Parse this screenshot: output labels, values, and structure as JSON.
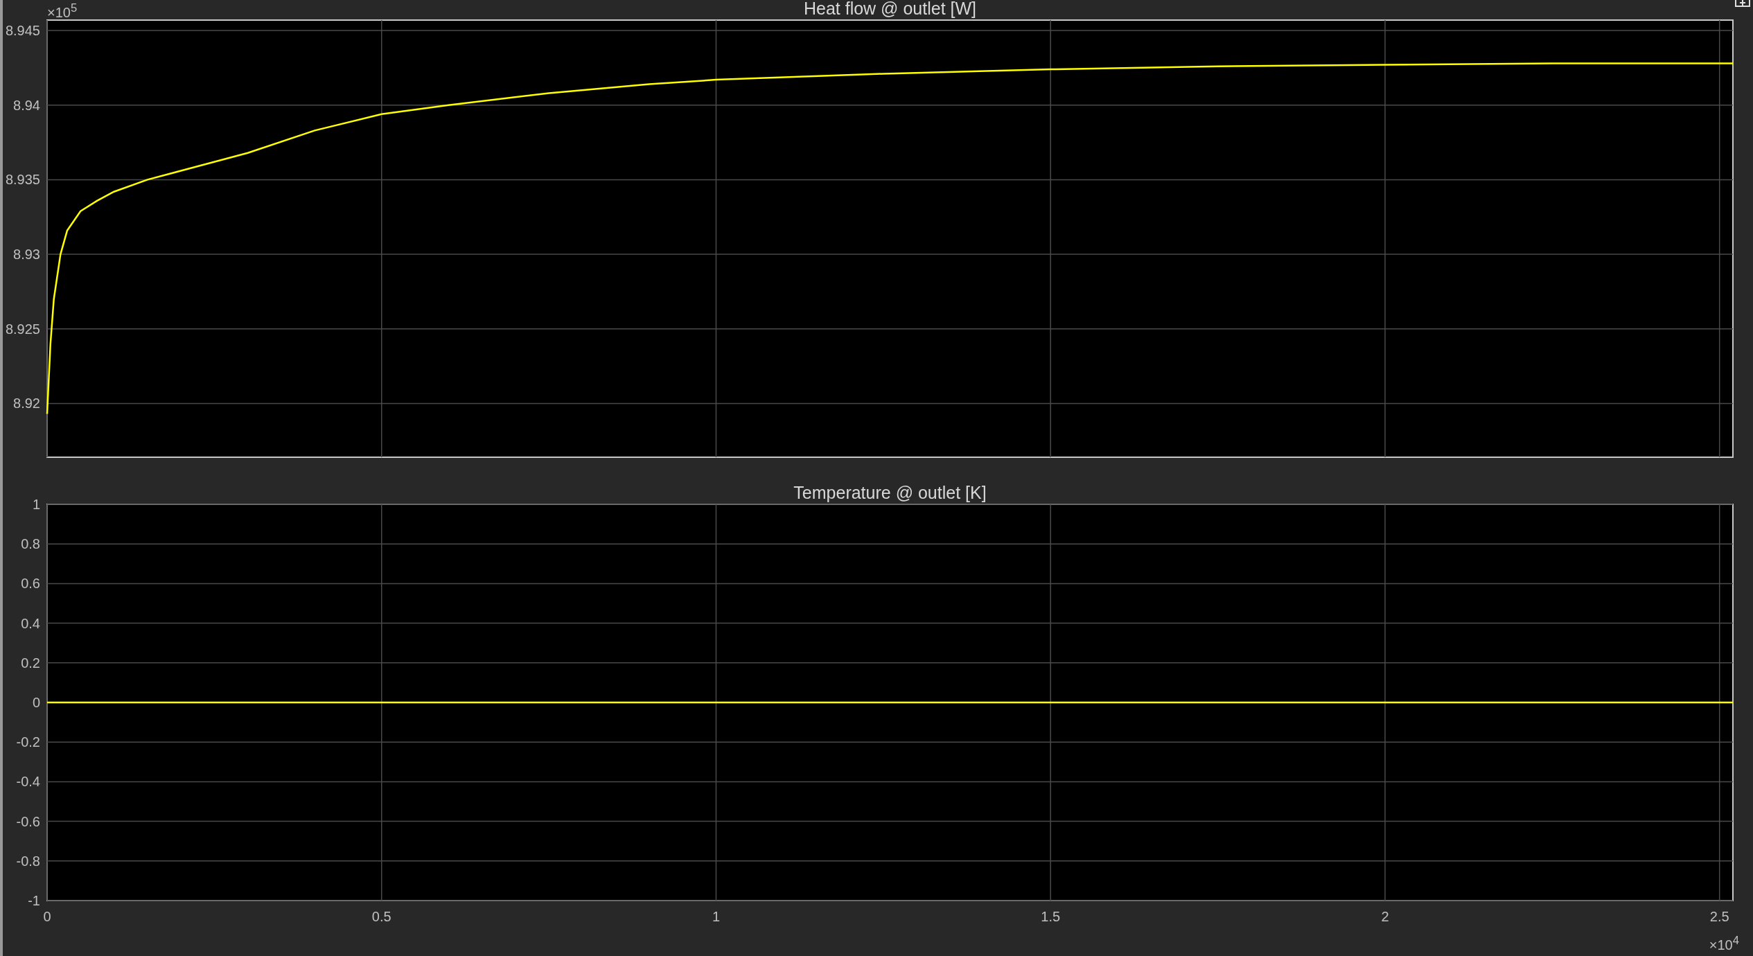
{
  "charts": [
    {
      "multiplier": "×10$^{5}$",
      "chart_data": {
        "type": "line",
        "title": "Heat flow @ outlet [W]",
        "grid": true,
        "xlim": [
          0,
          2.52
        ],
        "ylim": [
          8.9164,
          8.9457
        ],
        "yticks": [
          {
            "value": 8.92,
            "label": "8.92"
          },
          {
            "value": 8.925,
            "label": "8.925"
          },
          {
            "value": 8.93,
            "label": "8.93"
          },
          {
            "value": 8.935,
            "label": "8.935"
          },
          {
            "value": 8.94,
            "label": "8.94"
          },
          {
            "value": 8.945,
            "label": "8.945"
          }
        ],
        "x": [
          0,
          0.005,
          0.01,
          0.02,
          0.03,
          0.05,
          0.075,
          0.1,
          0.15,
          0.2,
          0.3,
          0.4,
          0.5,
          0.6,
          0.75,
          0.9,
          1,
          1.25,
          1.5,
          1.75,
          2,
          2.25,
          2.52
        ],
        "series": [
          {
            "color": "#ffff00",
            "values": [
              8.9193,
              8.924,
              8.927,
              8.93,
              8.9316,
              8.9329,
              8.9336,
              8.9342,
              8.935,
              8.9356,
              8.9368,
              8.9383,
              8.9394,
              8.94,
              8.9408,
              8.9414,
              8.9417,
              8.9421,
              8.9424,
              8.9426,
              8.9427,
              8.9428,
              8.9428
            ]
          }
        ]
      }
    },
    {
      "multiplier": "×10$^{4}$",
      "chart_data": {
        "type": "line",
        "title": "Temperature @ outlet [K]",
        "grid": true,
        "xlim": [
          0,
          2.52
        ],
        "ylim": [
          -1,
          1
        ],
        "xticks": [
          0,
          0.5,
          1,
          1.5,
          2,
          2.5
        ],
        "yticks": [
          -1,
          -0.8,
          -0.6,
          -0.4,
          -0.2,
          0,
          0.2,
          0.4,
          0.6,
          0.8,
          1
        ],
        "x": [
          0,
          2.52
        ],
        "series": [
          {
            "color": "#ffff00",
            "values": [
              0,
              0
            ]
          }
        ]
      }
    }
  ]
}
